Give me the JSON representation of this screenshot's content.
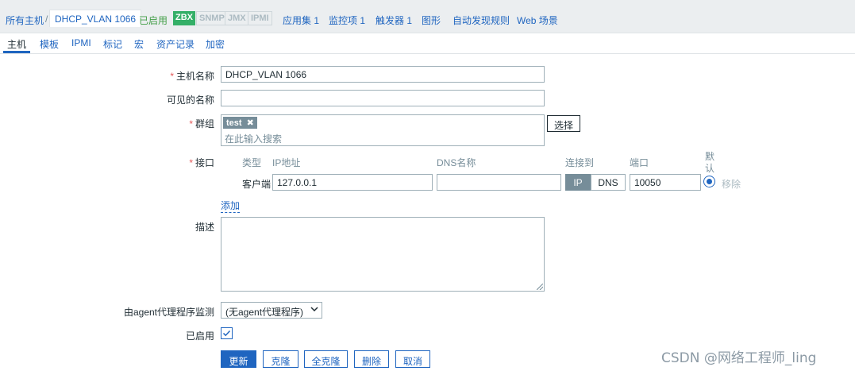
{
  "breadcrumb": {
    "all_hosts": "所有主机",
    "separator": "/",
    "host": "DHCP_VLAN 1066",
    "status": "已启用",
    "availability": [
      "ZBX",
      "SNMP",
      "JMX",
      "IPMI"
    ],
    "links": {
      "applications": "应用集 1",
      "items": "监控项 1",
      "triggers": "触发器 1",
      "graphs": "图形",
      "discovery": "自动发现规则",
      "web": "Web 场景"
    }
  },
  "tabs": [
    "主机",
    "模板",
    "IPMI",
    "标记",
    "宏",
    "资产记录",
    "加密"
  ],
  "form": {
    "required_mark": "*",
    "host_name_label": "主机名称",
    "host_name_value": "DHCP_VLAN 1066",
    "visible_name_label": "可见的名称",
    "visible_name_value": "",
    "groups_label": "群组",
    "group_tag": "test",
    "group_placeholder": "在此输入搜索",
    "select_button": "选择",
    "interfaces_label": "接口",
    "interface_headers": {
      "type": "类型",
      "ip": "IP地址",
      "dns": "DNS名称",
      "connect_to": "连接到",
      "port": "端口",
      "default_1": "默",
      "default_2": "认"
    },
    "interface": {
      "type": "客户端",
      "ip": "127.0.0.1",
      "dns": "",
      "connect_ip": "IP",
      "connect_dns": "DNS",
      "port": "10050",
      "remove": "移除"
    },
    "add_link": "添加",
    "description_label": "描述",
    "proxy_label": "由agent代理程序监测",
    "proxy_value": "(无agent代理程序)",
    "enabled_label": "已启用",
    "enabled_checked": true
  },
  "buttons": {
    "update": "更新",
    "clone": "克隆",
    "full_clone": "全克隆",
    "delete": "删除",
    "cancel": "取消"
  },
  "watermark": "CSDN @网络工程师_ling",
  "colors": {
    "link": "#1f65c0",
    "zbx_green": "#34af67",
    "enabled_green": "#429e47",
    "required_red": "#e45959"
  }
}
